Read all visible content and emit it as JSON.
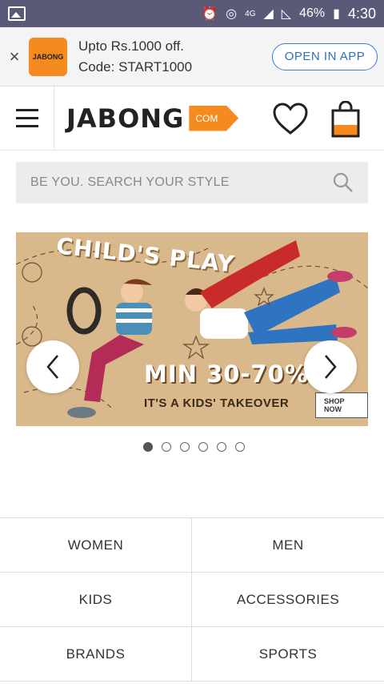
{
  "status_bar": {
    "network": "4G",
    "battery": "46%",
    "time": "4:30"
  },
  "app_banner": {
    "close": "×",
    "logo_text": "JABONG",
    "promo_line1": "Upto Rs.1000 off.",
    "promo_line2": "Code: START1000",
    "open_button": "OPEN IN APP"
  },
  "header": {
    "brand": "JABONG",
    "brand_tag": "COM"
  },
  "search": {
    "placeholder": "BE YOU. SEARCH YOUR STYLE"
  },
  "hero": {
    "title": "CHILD'S PLAY",
    "offer": "MIN 30-70%",
    "subtitle": "IT'S A KIDS' TAKEOVER",
    "cta": "SHOP NOW",
    "slide_count": 6,
    "active_slide": 1
  },
  "categories": [
    [
      "WOMEN",
      "MEN"
    ],
    [
      "KIDS",
      "ACCESSORIES"
    ],
    [
      "BRANDS",
      "SPORTS"
    ]
  ],
  "colors": {
    "brand_orange": "#f58a1f",
    "status_bar": "#5a5a78",
    "open_button_blue": "#2b6fc6"
  }
}
